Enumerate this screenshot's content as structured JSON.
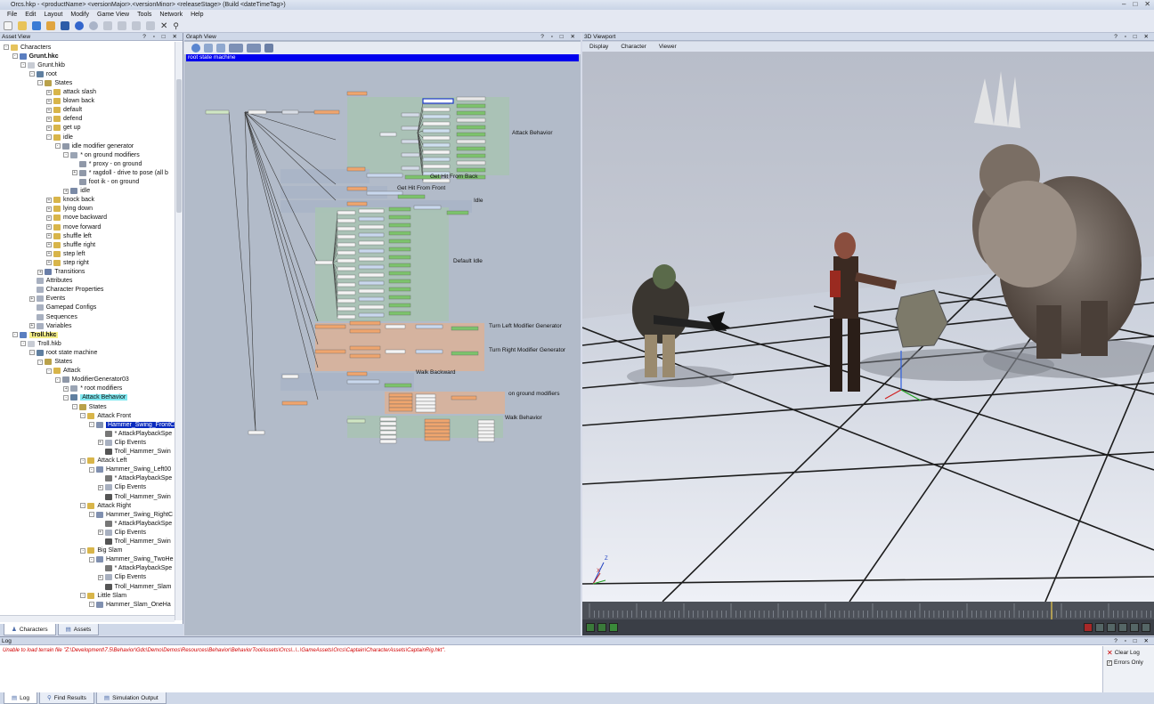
{
  "app": {
    "title": "Orcs.hkp - <productName> <versionMajor>.<versionMinor> <releaseStage> (Build <dateTimeTag>)",
    "window_controls": [
      "–",
      "□",
      "✕"
    ]
  },
  "menu": [
    "File",
    "Edit",
    "Layout",
    "Modify",
    "Game View",
    "Tools",
    "Network",
    "Help"
  ],
  "asset_view": {
    "title": "Asset View",
    "tree": [
      {
        "label": "Characters",
        "depth": 0,
        "icon": "folder-icon",
        "expand": "-"
      },
      {
        "label": "Grunt.hkc",
        "depth": 1,
        "icon": "character-icon",
        "expand": "-",
        "bold": true
      },
      {
        "label": "Grunt.hkb",
        "depth": 2,
        "icon": "behavior-file-icon",
        "expand": "-"
      },
      {
        "label": "root",
        "depth": 3,
        "icon": "state-machine-icon",
        "expand": "-"
      },
      {
        "label": "States",
        "depth": 4,
        "icon": "states-icon",
        "expand": "-"
      },
      {
        "label": "attack slash",
        "depth": 5,
        "icon": "state-icon",
        "expand": "+"
      },
      {
        "label": "blown back",
        "depth": 5,
        "icon": "state-icon",
        "expand": "+"
      },
      {
        "label": "default",
        "depth": 5,
        "icon": "state-icon",
        "expand": "+"
      },
      {
        "label": "defend",
        "depth": 5,
        "icon": "state-icon",
        "expand": "+"
      },
      {
        "label": "get up",
        "depth": 5,
        "icon": "state-icon",
        "expand": "+"
      },
      {
        "label": "idle",
        "depth": 5,
        "icon": "state-icon",
        "expand": "-"
      },
      {
        "label": "idle modifier generator",
        "depth": 6,
        "icon": "modifier-icon",
        "expand": "-"
      },
      {
        "label": "* on ground modifiers",
        "depth": 7,
        "icon": "modifier-list-icon",
        "expand": "-"
      },
      {
        "label": "* proxy - on ground",
        "depth": 8,
        "icon": "modifier-icon",
        "expand": ""
      },
      {
        "label": "* ragdoll - drive to pose (all b",
        "depth": 8,
        "icon": "modifier-icon",
        "expand": "+"
      },
      {
        "label": "foot ik - on ground",
        "depth": 8,
        "icon": "modifier-icon",
        "expand": ""
      },
      {
        "label": "idle",
        "depth": 7,
        "icon": "generator-icon",
        "expand": "+"
      },
      {
        "label": "knock back",
        "depth": 5,
        "icon": "state-icon",
        "expand": "+"
      },
      {
        "label": "lying down",
        "depth": 5,
        "icon": "state-icon",
        "expand": "+"
      },
      {
        "label": "move backward",
        "depth": 5,
        "icon": "state-icon",
        "expand": "+"
      },
      {
        "label": "move forward",
        "depth": 5,
        "icon": "state-icon",
        "expand": "+"
      },
      {
        "label": "shuffle left",
        "depth": 5,
        "icon": "state-icon",
        "expand": "+"
      },
      {
        "label": "shuffle right",
        "depth": 5,
        "icon": "state-icon",
        "expand": "+"
      },
      {
        "label": "step left",
        "depth": 5,
        "icon": "state-icon",
        "expand": "+"
      },
      {
        "label": "step right",
        "depth": 5,
        "icon": "state-icon",
        "expand": "+"
      },
      {
        "label": "Transitions",
        "depth": 4,
        "icon": "transitions-icon",
        "expand": "+"
      },
      {
        "label": "Attributes",
        "depth": 3,
        "icon": "attributes-icon",
        "expand": ""
      },
      {
        "label": "Character Properties",
        "depth": 3,
        "icon": "properties-icon",
        "expand": ""
      },
      {
        "label": "Events",
        "depth": 3,
        "icon": "events-icon",
        "expand": "+"
      },
      {
        "label": "Gamepad Configs",
        "depth": 3,
        "icon": "gamepad-icon",
        "expand": ""
      },
      {
        "label": "Sequences",
        "depth": 3,
        "icon": "sequences-icon",
        "expand": ""
      },
      {
        "label": "Variables",
        "depth": 3,
        "icon": "variables-icon",
        "expand": "+"
      },
      {
        "label": "Troll.hkc",
        "depth": 1,
        "icon": "character-icon",
        "expand": "-",
        "bold": true,
        "highlight": "yellow"
      },
      {
        "label": "Troll.hkb",
        "depth": 2,
        "icon": "behavior-file-icon",
        "expand": "-"
      },
      {
        "label": "root state machine",
        "depth": 3,
        "icon": "state-machine-icon",
        "expand": "-"
      },
      {
        "label": "States",
        "depth": 4,
        "icon": "states-icon",
        "expand": "-"
      },
      {
        "label": "Attack",
        "depth": 5,
        "icon": "state-icon",
        "expand": "-"
      },
      {
        "label": "ModifierGenerator03",
        "depth": 6,
        "icon": "modifier-icon",
        "expand": "-"
      },
      {
        "label": "* root modifiers",
        "depth": 7,
        "icon": "modifier-list-icon",
        "expand": "+"
      },
      {
        "label": "Attack Behavior",
        "depth": 7,
        "icon": "state-machine-icon",
        "expand": "-",
        "highlight": "cyan"
      },
      {
        "label": "States",
        "depth": 8,
        "icon": "states-icon",
        "expand": "-"
      },
      {
        "label": "Attack Front",
        "depth": 9,
        "icon": "state-icon",
        "expand": "-"
      },
      {
        "label": "Hammer_Swing_FrontC",
        "depth": 10,
        "icon": "clip-generator-icon",
        "expand": "-",
        "highlight": "selected"
      },
      {
        "label": "* AttackPlaybackSpe",
        "depth": 11,
        "icon": "gear-icon",
        "expand": ""
      },
      {
        "label": "Clip Events",
        "depth": 11,
        "icon": "events-icon",
        "expand": "+"
      },
      {
        "label": "Troll_Hammer_Swin",
        "depth": 11,
        "icon": "animation-icon",
        "expand": ""
      },
      {
        "label": "Attack Left",
        "depth": 9,
        "icon": "state-icon",
        "expand": "-"
      },
      {
        "label": "Hammer_Swing_Left00",
        "depth": 10,
        "icon": "clip-generator-icon",
        "expand": "-"
      },
      {
        "label": "* AttackPlaybackSpe",
        "depth": 11,
        "icon": "gear-icon",
        "expand": ""
      },
      {
        "label": "Clip Events",
        "depth": 11,
        "icon": "events-icon",
        "expand": "+"
      },
      {
        "label": "Troll_Hammer_Swin",
        "depth": 11,
        "icon": "animation-icon",
        "expand": ""
      },
      {
        "label": "Attack Right",
        "depth": 9,
        "icon": "state-icon",
        "expand": "-"
      },
      {
        "label": "Hammer_Swing_RightC",
        "depth": 10,
        "icon": "clip-generator-icon",
        "expand": "-"
      },
      {
        "label": "* AttackPlaybackSpe",
        "depth": 11,
        "icon": "gear-icon",
        "expand": ""
      },
      {
        "label": "Clip Events",
        "depth": 11,
        "icon": "events-icon",
        "expand": "+"
      },
      {
        "label": "Troll_Hammer_Swin",
        "depth": 11,
        "icon": "animation-icon",
        "expand": ""
      },
      {
        "label": "Big Slam",
        "depth": 9,
        "icon": "state-icon",
        "expand": "-"
      },
      {
        "label": "Hammer_Swing_TwoHe",
        "depth": 10,
        "icon": "clip-generator-icon",
        "expand": "-"
      },
      {
        "label": "* AttackPlaybackSpe",
        "depth": 11,
        "icon": "gear-icon",
        "expand": ""
      },
      {
        "label": "Clip Events",
        "depth": 11,
        "icon": "events-icon",
        "expand": "+"
      },
      {
        "label": "Troll_Hammer_Slam",
        "depth": 11,
        "icon": "animation-icon",
        "expand": ""
      },
      {
        "label": "Little Slam",
        "depth": 9,
        "icon": "state-icon",
        "expand": "-"
      },
      {
        "label": "Hammer_Slam_OneHa",
        "depth": 10,
        "icon": "clip-generator-icon",
        "expand": "-"
      }
    ],
    "tabs": [
      "Characters",
      "Assets"
    ]
  },
  "graph_view": {
    "title": "Graph View",
    "banner": "root state machine",
    "group_labels": [
      "Attack Behavior",
      "Get Hit From Back",
      "Get Hit From Front",
      "Idle",
      "Default Idle",
      "Turn Left Modifier Generator",
      "Turn Right Modifier Generator",
      "Walk Backward",
      "on ground modifiers",
      "Walk Behavior"
    ]
  },
  "viewport": {
    "title": "3D Viewport",
    "menu": [
      "Display",
      "Character",
      "Viewer"
    ],
    "axis_labels": [
      "Z",
      "X"
    ]
  },
  "log": {
    "title": "Log",
    "message": "Unable to load terrain file \"Z:\\Development\\7.5\\Behavior\\Gdc\\Demo\\Demos\\Resources\\Behavior\\BehaviorToolAssets\\Orcs\\..\\..\\GameAssets\\Orcs\\Captain\\CharacterAssets\\CaptainRig.hkt\".",
    "clear_label": "Clear Log",
    "errors_only_label": "Errors Only",
    "tabs": [
      "Log",
      "Find Results",
      "Simulation Output"
    ]
  },
  "panel_controls": "? ▫ □ ✕",
  "colors": {
    "accent": "#0000ee",
    "selected": "#0a2bbf",
    "yellow_highlight": "#f6f08a",
    "cyan_highlight": "#7fe8f0",
    "error": "#d00000"
  }
}
